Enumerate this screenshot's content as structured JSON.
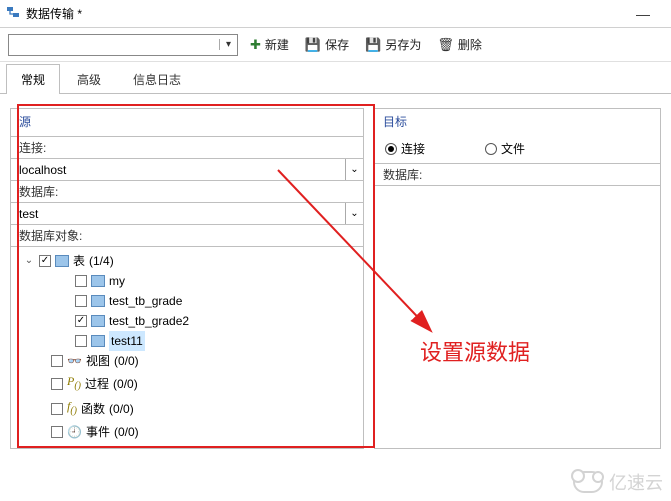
{
  "window": {
    "title": "数据传输 *"
  },
  "toolbar": {
    "combo_value": "",
    "new": "新建",
    "save": "保存",
    "save_as": "另存为",
    "delete": "删除"
  },
  "tabs": [
    "常规",
    "高级",
    "信息日志"
  ],
  "active_tab": 0,
  "source": {
    "title": "源",
    "conn_label": "连接:",
    "conn_value": "localhost",
    "db_label": "数据库:",
    "db_value": "test",
    "objects_label": "数据库对象:",
    "tree": {
      "tables": {
        "label": "表",
        "count": "(1/4)",
        "checked": true,
        "expanded": true,
        "items": [
          {
            "name": "my",
            "checked": false
          },
          {
            "name": "test_tb_grade",
            "checked": false
          },
          {
            "name": "test_tb_grade2",
            "checked": true
          },
          {
            "name": "test11",
            "checked": false,
            "selected": true
          }
        ]
      },
      "views": {
        "label": "视图",
        "count": "(0/0)"
      },
      "procedures": {
        "label": "过程",
        "count": "(0/0)"
      },
      "functions": {
        "label": "函数",
        "count": "(0/0)"
      },
      "events": {
        "label": "事件",
        "count": "(0/0)"
      }
    }
  },
  "target": {
    "title": "目标",
    "opt_conn": "连接",
    "opt_file": "文件",
    "selected": "conn",
    "db_label": "数据库:",
    "db_value": ""
  },
  "annotation": "设置源数据",
  "watermark": "亿速云"
}
